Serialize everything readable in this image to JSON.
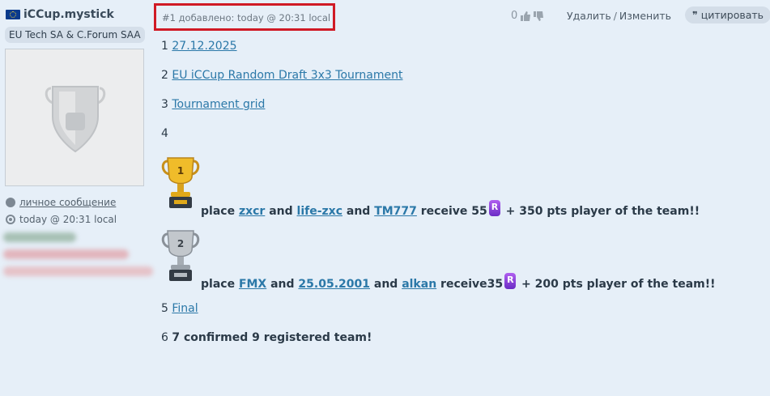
{
  "sidebar": {
    "username": "iCCup.mystick",
    "user_tag": "EU Tech SA & C.Forum SAA",
    "private_message": "личное сообщение",
    "time": "today @ 20:31 local"
  },
  "post": {
    "number_label": "#1 добавлено: today @ 20:31 local",
    "vote_count": "0",
    "delete_label": "Удалить",
    "separator": "/",
    "edit_label": "Изменить",
    "quote_label": "цитировать"
  },
  "content": {
    "line1": {
      "num": "1",
      "link": "27.12.2025"
    },
    "line2": {
      "num": "2",
      "link": "EU iCCup Random Draft 3x3 Tournament"
    },
    "line3": {
      "num": "3",
      "link": "Tournament grid"
    },
    "line4": {
      "num": "4"
    },
    "place1": {
      "trophy_digit": "1",
      "place": "place",
      "p1": "zxcr",
      "and1": "and",
      "p2": "life-zxc",
      "and2": "and",
      "p3": "TM777",
      "receive": "receive 55",
      "reward": "+ 350 pts player of the team!!"
    },
    "place2": {
      "trophy_digit": "2",
      "place": "place",
      "p1": "FMX",
      "and1": "and",
      "p2": "25.05.2001",
      "and2": "and",
      "p3": "alkan",
      "receive": "receive35",
      "reward": "+ 200 pts player of the team!!"
    },
    "line5": {
      "num": "5",
      "link": "Final"
    },
    "line6": {
      "num": "6",
      "text": "7 confirmed 9 registered team!"
    }
  },
  "colors": {
    "background": "#e6eff8",
    "link": "#2b78a8",
    "highlight_box": "#d01a25",
    "gold": "#e0a91a",
    "silver": "#9aa2aa"
  }
}
